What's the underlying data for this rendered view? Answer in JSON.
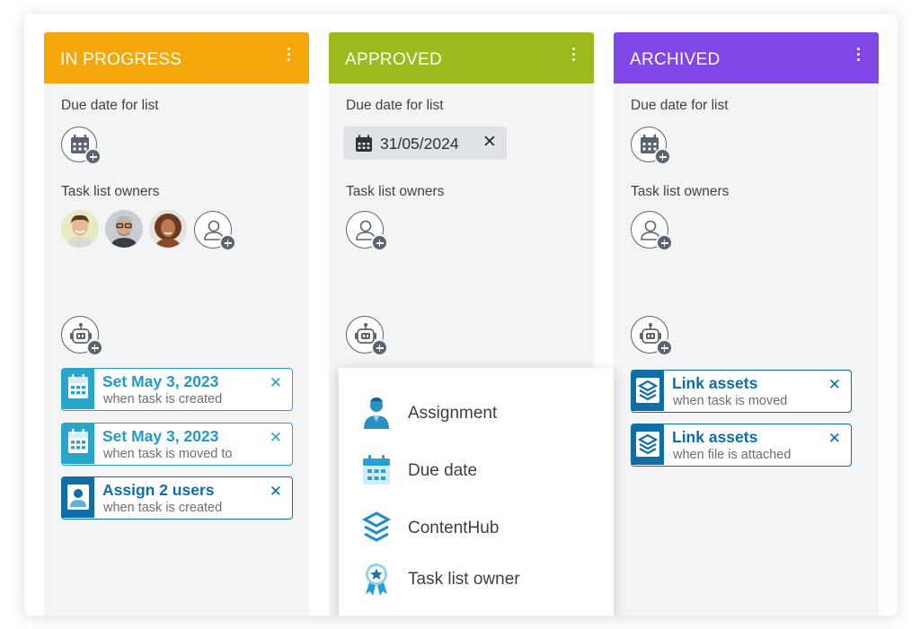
{
  "lists": [
    {
      "title": "IN PROGRESS",
      "color": "#f4a70a",
      "due_label": "Due date for list",
      "owners_label": "Task list owners",
      "rules": [
        {
          "title": "Set May 3, 2023",
          "subtitle": "when task is created",
          "icon": "calendar-icon",
          "color": "#29a5c9"
        },
        {
          "title": "Set May 3, 2023",
          "subtitle": "when task is moved to",
          "icon": "calendar-icon",
          "color": "#29a5c9"
        },
        {
          "title": "Assign 2 users",
          "subtitle": "when task is created",
          "icon": "user-icon",
          "color": "#0f6ea8"
        }
      ]
    },
    {
      "title": "APPROVED",
      "color": "#9cba1e",
      "due_label": "Due date for list",
      "due_value": "31/05/2024",
      "owners_label": "Task list owners",
      "rules": []
    },
    {
      "title": "ARCHIVED",
      "color": "#7e47e6",
      "due_label": "Due date for list",
      "owners_label": "Task list owners",
      "rules": [
        {
          "title": "Link assets",
          "subtitle": "when task is moved",
          "icon": "layers-icon",
          "color": "#0f6ea8"
        },
        {
          "title": "Link assets",
          "subtitle": "when file is attached",
          "icon": "layers-icon",
          "color": "#0f6ea8"
        }
      ]
    }
  ],
  "remove_symbol": "✕",
  "dropdown": {
    "items": [
      {
        "label": "Assignment",
        "icon": "user-icon"
      },
      {
        "label": "Due date",
        "icon": "calendar-icon"
      },
      {
        "label": "ContentHub",
        "icon": "layers-icon"
      },
      {
        "label": "Task list owner",
        "icon": "award-icon"
      }
    ]
  },
  "colors": {
    "panel_bg": "#f3f4f6",
    "rule_calendar": "#29a5c9",
    "rule_dark": "#0f6ea8",
    "icon_outline": "#5a6470"
  }
}
